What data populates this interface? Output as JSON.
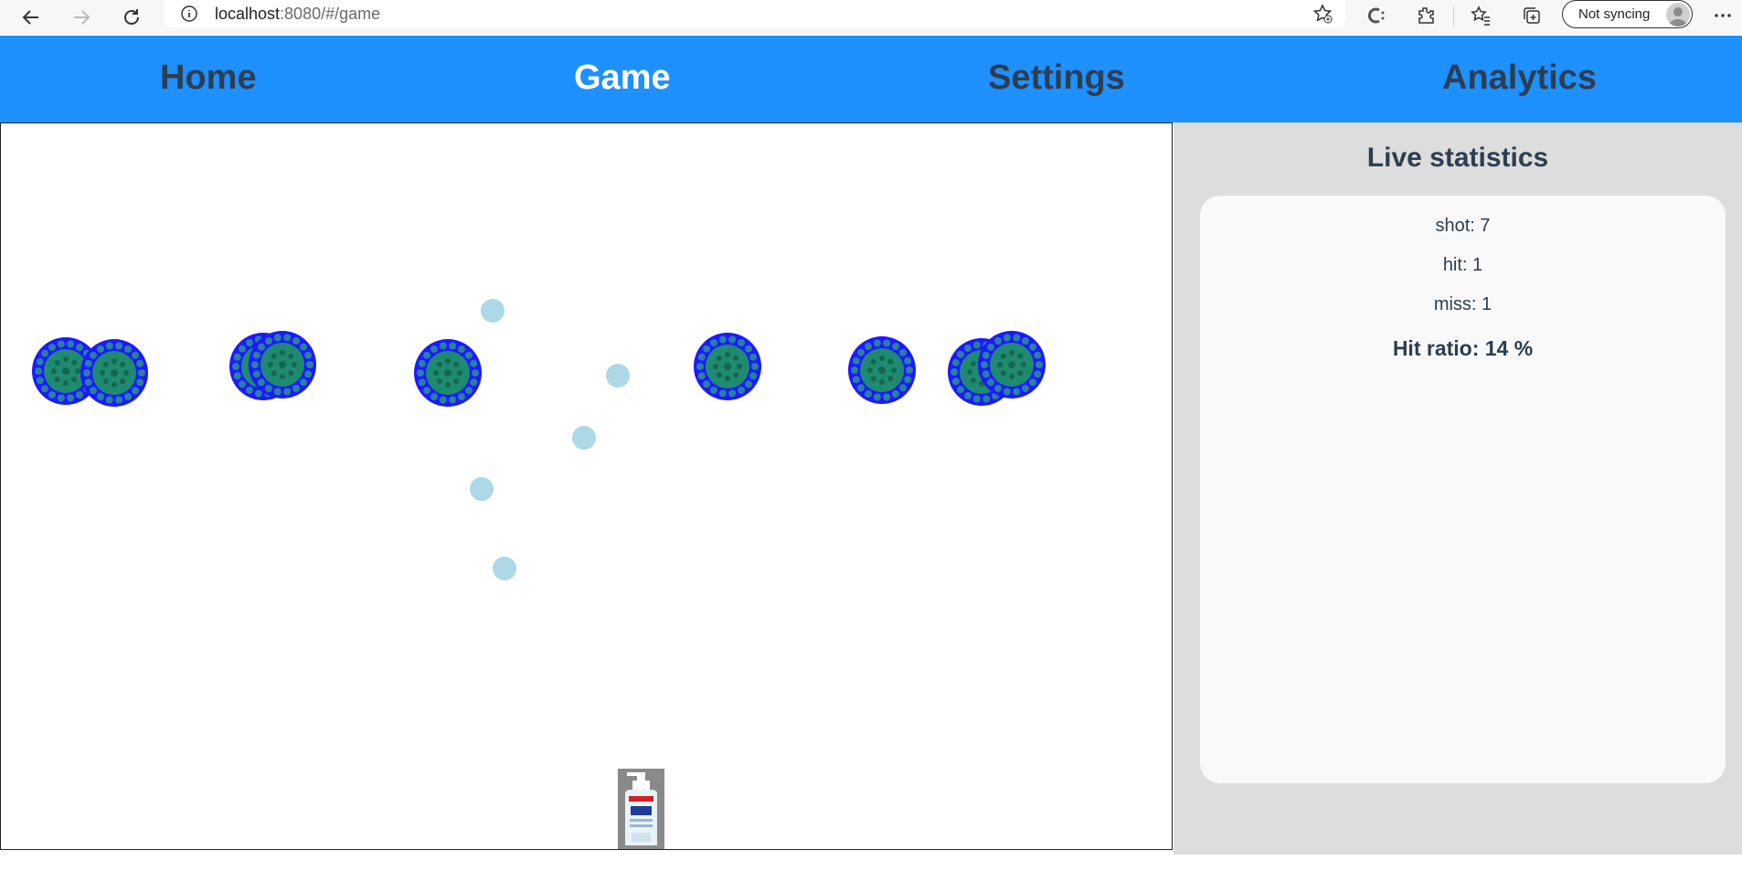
{
  "browser": {
    "url_host": "localhost",
    "url_rest": ":8080/#/game",
    "sync_label": "Not syncing"
  },
  "nav": {
    "home": "Home",
    "game": "Game",
    "settings": "Settings",
    "analytics": "Analytics",
    "active": "Game"
  },
  "game": {
    "virus_count": 9,
    "bullet_count": 5
  },
  "stats": {
    "title": "Live statistics",
    "shot": "shot: 7",
    "hit": "hit: 1",
    "miss": "miss: 1",
    "ratio": "Hit ratio: 14 %"
  },
  "colors": {
    "nav_bg": "#1e90ff",
    "nav_text": "#2c3e50",
    "nav_active": "#ffffff",
    "bullet": "#add8e6",
    "virus_ring": "#1a1aff",
    "virus_core": "#1e8a70"
  }
}
